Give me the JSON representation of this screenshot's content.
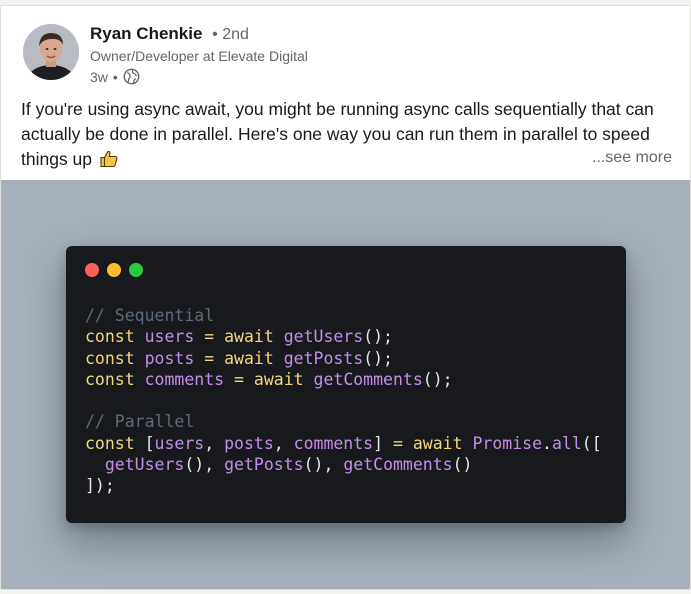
{
  "post": {
    "author": {
      "name": "Ryan Chenkie",
      "separator": "•",
      "degree": "2nd",
      "headline": "Owner/Developer at Elevate Digital"
    },
    "meta": {
      "time": "3w",
      "separator": "•",
      "visibility_icon": "globe-icon"
    },
    "text": "If you're using async await, you might be running async calls sequentially that can actually be done in parallel. Here's one way you can run them in parallel to speed things up",
    "text_icon": "thumbs-up-icon",
    "see_more": "...see more"
  },
  "colors": {
    "image_bg": "#a5b0ba",
    "code_bg": "#17191d",
    "dot_red": "#ff5f56",
    "dot_yellow": "#ffbd2e",
    "dot_green": "#27c93f",
    "keyword": "#f5d67b",
    "variable": "#c48ee8",
    "function": "#c48ee8",
    "comment": "#5d6b7a",
    "punct": "#e6e6e6"
  },
  "code_lines": [
    [
      {
        "t": "// Sequential",
        "c": "comment"
      }
    ],
    [
      {
        "t": "const ",
        "c": "keyword"
      },
      {
        "t": "users",
        "c": "variable"
      },
      {
        "t": " = ",
        "c": "keyword"
      },
      {
        "t": "await ",
        "c": "keyword"
      },
      {
        "t": "getUsers",
        "c": "function"
      },
      {
        "t": "();",
        "c": "punct"
      }
    ],
    [
      {
        "t": "const ",
        "c": "keyword"
      },
      {
        "t": "posts",
        "c": "variable"
      },
      {
        "t": " = ",
        "c": "keyword"
      },
      {
        "t": "await ",
        "c": "keyword"
      },
      {
        "t": "getPosts",
        "c": "function"
      },
      {
        "t": "();",
        "c": "punct"
      }
    ],
    [
      {
        "t": "const ",
        "c": "keyword"
      },
      {
        "t": "comments",
        "c": "variable"
      },
      {
        "t": " = ",
        "c": "keyword"
      },
      {
        "t": "await ",
        "c": "keyword"
      },
      {
        "t": "getComments",
        "c": "function"
      },
      {
        "t": "();",
        "c": "punct"
      }
    ],
    [],
    [
      {
        "t": "// Parallel",
        "c": "comment"
      }
    ],
    [
      {
        "t": "const ",
        "c": "keyword"
      },
      {
        "t": "[",
        "c": "punct"
      },
      {
        "t": "users",
        "c": "variable"
      },
      {
        "t": ", ",
        "c": "punct"
      },
      {
        "t": "posts",
        "c": "variable"
      },
      {
        "t": ", ",
        "c": "punct"
      },
      {
        "t": "comments",
        "c": "variable"
      },
      {
        "t": "] ",
        "c": "punct"
      },
      {
        "t": "= ",
        "c": "keyword"
      },
      {
        "t": "await ",
        "c": "keyword"
      },
      {
        "t": "Promise",
        "c": "function"
      },
      {
        "t": ".",
        "c": "punct"
      },
      {
        "t": "all",
        "c": "function"
      },
      {
        "t": "([",
        "c": "punct"
      }
    ],
    [
      {
        "t": "  getUsers",
        "c": "function"
      },
      {
        "t": "(), ",
        "c": "punct"
      },
      {
        "t": "getPosts",
        "c": "function"
      },
      {
        "t": "(), ",
        "c": "punct"
      },
      {
        "t": "getComments",
        "c": "function"
      },
      {
        "t": "()",
        "c": "punct"
      }
    ],
    [
      {
        "t": "]);",
        "c": "punct"
      }
    ]
  ]
}
